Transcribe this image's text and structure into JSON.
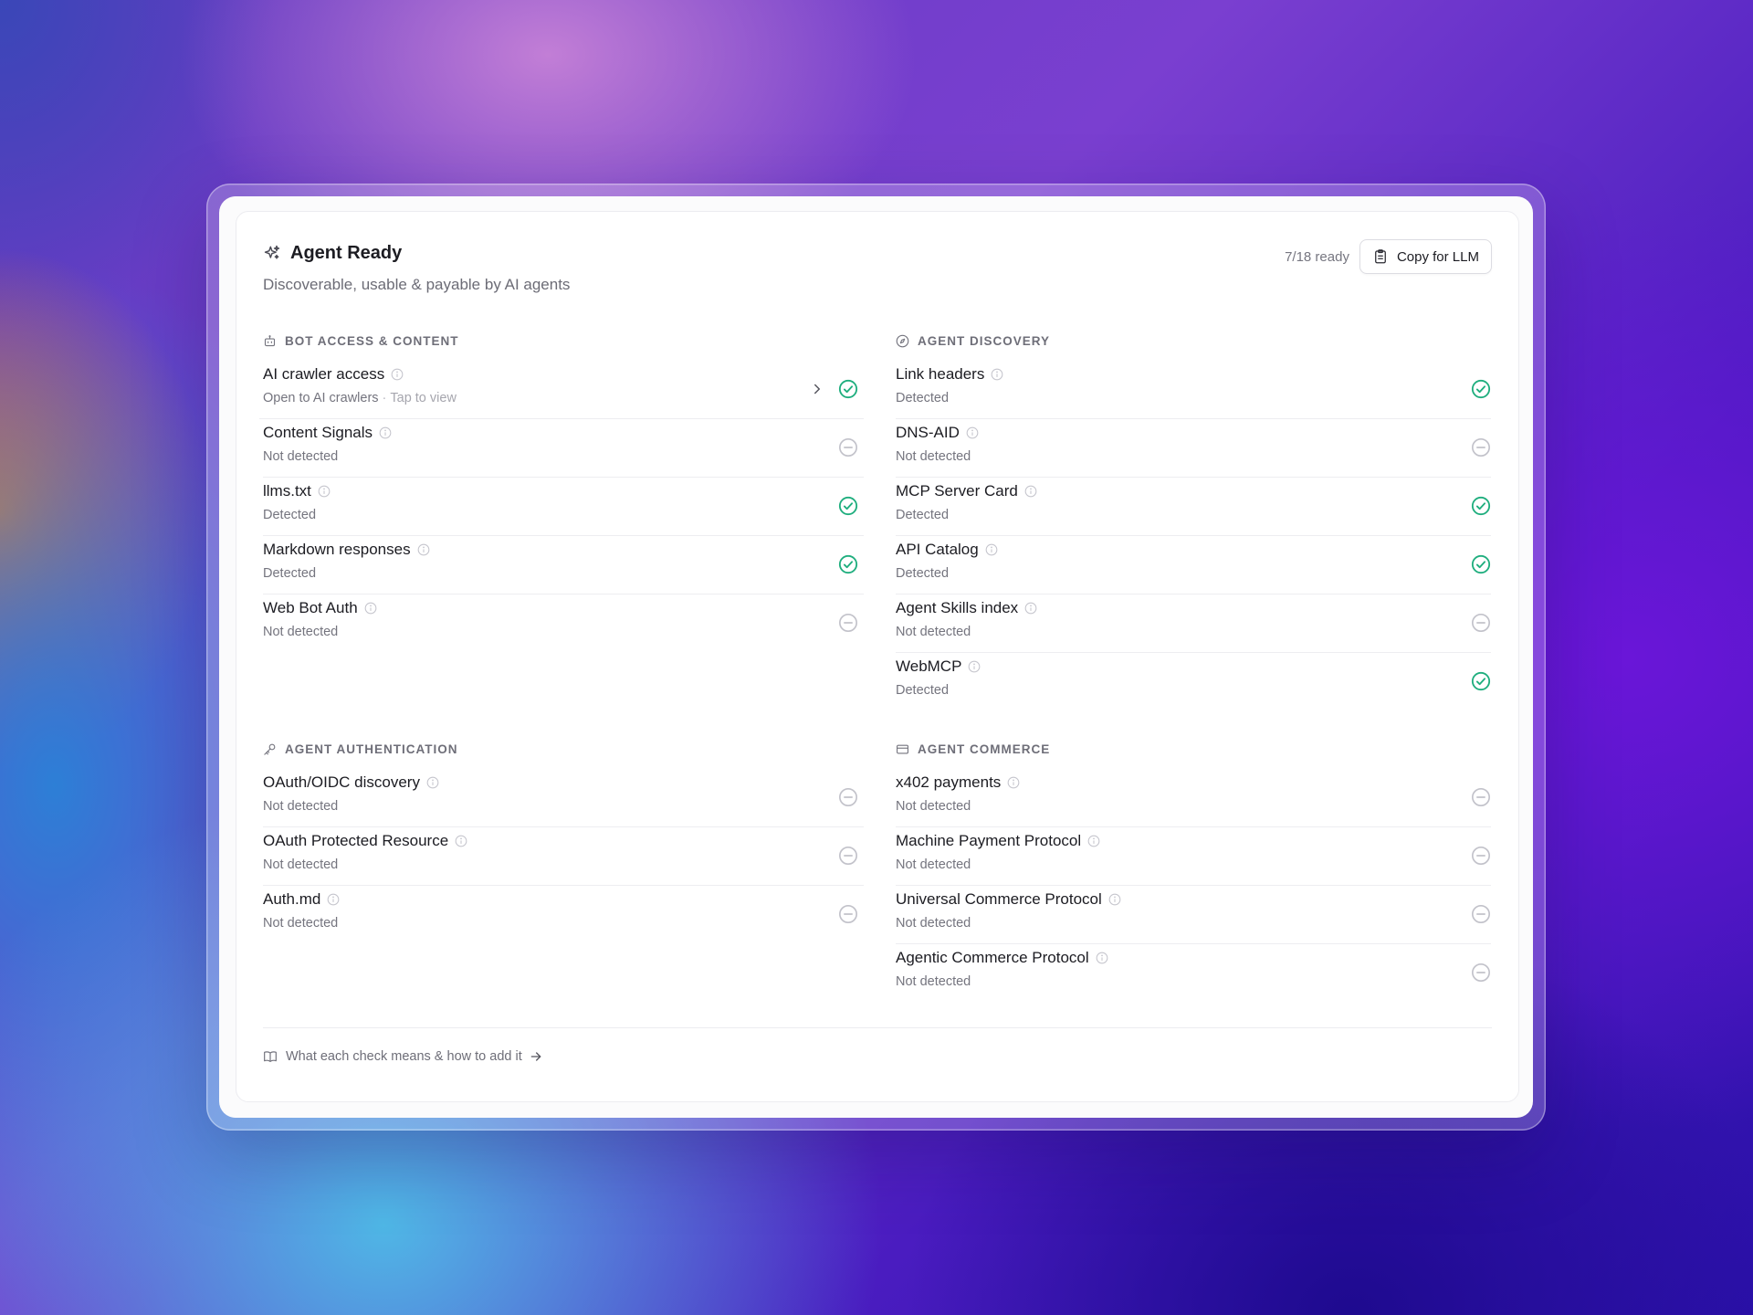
{
  "header": {
    "title": "Agent Ready",
    "subtitle": "Discoverable, usable & payable by AI agents",
    "ready_count": "7/18 ready",
    "copy_label": "Copy for LLM",
    "title_icon": "sparkles-icon",
    "copy_icon": "clipboard-icon"
  },
  "colors": {
    "detected": "#1fae7e",
    "not_detected": "#c2c2ca"
  },
  "sections": [
    {
      "title": "BOT ACCESS & CONTENT",
      "icon": "bot-icon",
      "items": [
        {
          "name": "AI crawler access",
          "status": "Open to AI crawlers",
          "hint": "Tap to view",
          "state": "detected"
        },
        {
          "name": "Content Signals",
          "status": "Not detected",
          "state": "not-detected"
        },
        {
          "name": "llms.txt",
          "status": "Detected",
          "state": "detected"
        },
        {
          "name": "Markdown responses",
          "status": "Detected",
          "state": "detected"
        },
        {
          "name": "Web Bot Auth",
          "status": "Not detected",
          "state": "not-detected"
        }
      ]
    },
    {
      "title": "AGENT DISCOVERY",
      "icon": "compass-icon",
      "items": [
        {
          "name": "Link headers",
          "status": "Detected",
          "state": "detected"
        },
        {
          "name": "DNS-AID",
          "status": "Not detected",
          "state": "not-detected"
        },
        {
          "name": "MCP Server Card",
          "status": "Detected",
          "state": "detected"
        },
        {
          "name": "API Catalog",
          "status": "Detected",
          "state": "detected"
        },
        {
          "name": "Agent Skills index",
          "status": "Not detected",
          "state": "not-detected"
        },
        {
          "name": "WebMCP",
          "status": "Detected",
          "state": "detected"
        }
      ]
    },
    {
      "title": "AGENT AUTHENTICATION",
      "icon": "key-icon",
      "items": [
        {
          "name": "OAuth/OIDC discovery",
          "status": "Not detected",
          "state": "not-detected"
        },
        {
          "name": "OAuth Protected Resource",
          "status": "Not detected",
          "state": "not-detected"
        },
        {
          "name": "Auth.md",
          "status": "Not detected",
          "state": "not-detected"
        }
      ]
    },
    {
      "title": "AGENT COMMERCE",
      "icon": "credit-card-icon",
      "items": [
        {
          "name": "x402 payments",
          "status": "Not detected",
          "state": "not-detected"
        },
        {
          "name": "Machine Payment Protocol",
          "status": "Not detected",
          "state": "not-detected"
        },
        {
          "name": "Universal Commerce Protocol",
          "status": "Not detected",
          "state": "not-detected"
        },
        {
          "name": "Agentic Commerce Protocol",
          "status": "Not detected",
          "state": "not-detected"
        }
      ]
    }
  ],
  "footer": {
    "link_text": "What each check means & how to add it",
    "icon": "book-icon"
  }
}
